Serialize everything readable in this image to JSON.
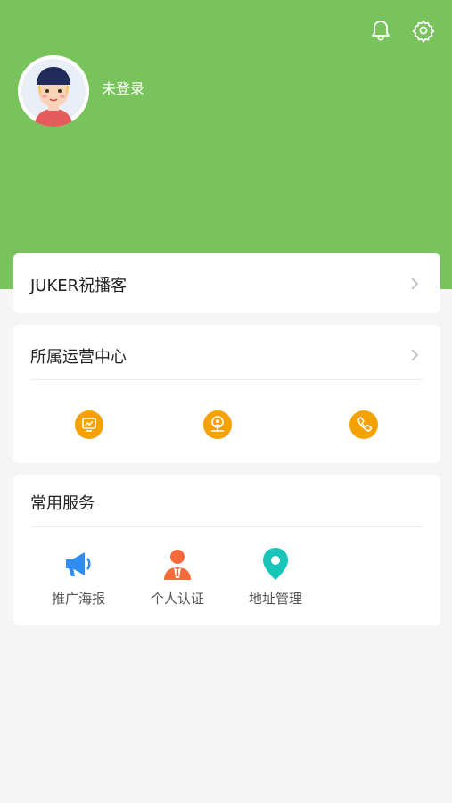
{
  "header": {
    "status_text": "未登录",
    "colors": {
      "accent": "#78c35b"
    }
  },
  "cards": {
    "juker": {
      "title": "JUKER祝播客"
    },
    "operation_center": {
      "title": "所属运营中心",
      "icons": [
        "chart-board-icon",
        "location-person-icon",
        "phone-icon"
      ],
      "icon_color": "#f5a200"
    },
    "services": {
      "title": "常用服务",
      "items": [
        {
          "label": "推广海报",
          "icon": "megaphone-icon",
          "color": "#2f8cf0"
        },
        {
          "label": "个人认证",
          "icon": "person-suit-icon",
          "color": "#f56a3a"
        },
        {
          "label": "地址管理",
          "icon": "map-pin-icon",
          "color": "#17c6b9"
        }
      ]
    }
  }
}
